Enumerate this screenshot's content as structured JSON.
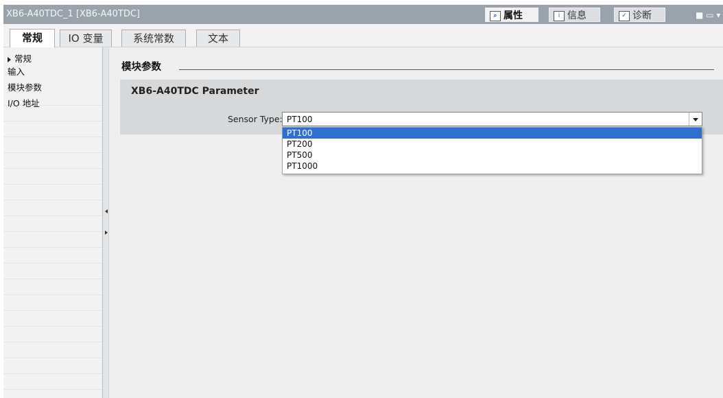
{
  "window": {
    "title": "XB6-A40TDC_1 [XB6-A40TDC]"
  },
  "top_tabs": [
    {
      "label": "属性",
      "icon": "properties-icon",
      "active": true
    },
    {
      "label": "信息",
      "icon": "info-icon",
      "active": false
    },
    {
      "label": "诊断",
      "icon": "diagnostics-icon",
      "active": false
    }
  ],
  "main_tabs": [
    {
      "label": "常规",
      "active": true
    },
    {
      "label": "IO 变量",
      "active": false
    },
    {
      "label": "系统常数",
      "active": false
    },
    {
      "label": "文本",
      "active": false
    }
  ],
  "nav": {
    "items": [
      {
        "label": "常规",
        "expandable": true
      },
      {
        "label": "输入"
      },
      {
        "label": "模块参数"
      },
      {
        "label": "I/O 地址"
      }
    ]
  },
  "content": {
    "section_title": "模块参数",
    "panel_title": "XB6-A40TDC Parameter",
    "sensor_type_label": "Sensor Type:",
    "sensor_type_value": "PT100",
    "options": [
      "PT100",
      "PT200",
      "PT500",
      "PT1000"
    ],
    "selected_option": "PT100"
  },
  "colors": {
    "titlebar": "#9aa3ab",
    "selection": "#2f6fd0",
    "panel": "#d6d8da"
  }
}
